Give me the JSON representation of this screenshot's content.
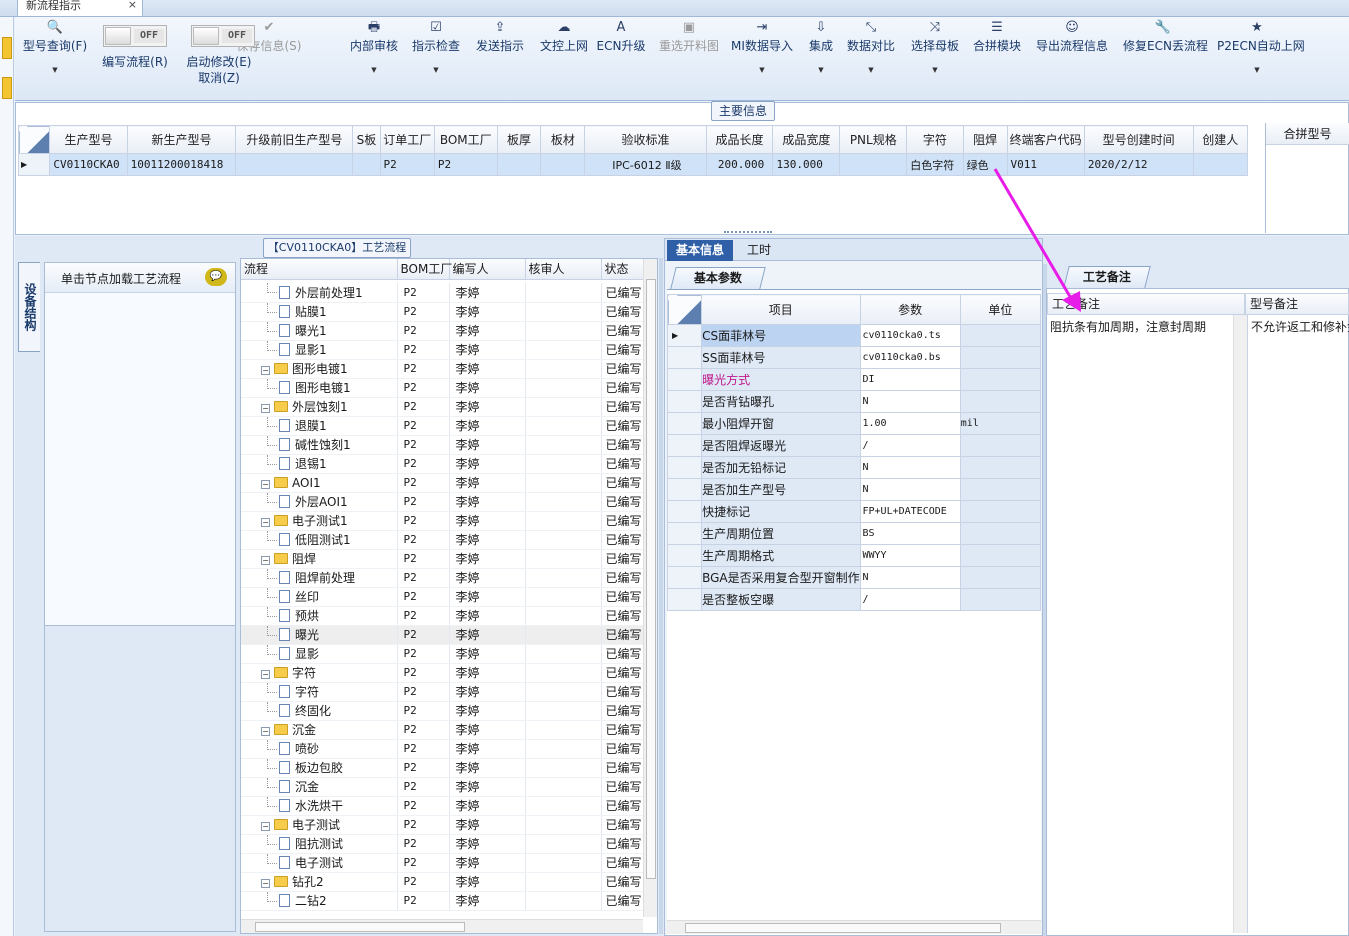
{
  "window": {
    "tab_title": "新流程指示",
    "close_glyph": "×"
  },
  "toolbar": {
    "items": [
      {
        "label": "型号查询(F)",
        "icon": "search-icon",
        "glyph": "🔍",
        "dropdown": true,
        "disabled": false
      },
      {
        "label": "保存信息(S)",
        "icon": "check-icon",
        "glyph": "✔",
        "dropdown": false,
        "disabled": true
      },
      {
        "label": "内部审核",
        "icon": "printer-icon",
        "glyph": "🖶",
        "dropdown": true,
        "disabled": false
      },
      {
        "label": "指示检查",
        "icon": "checkbox-icon",
        "glyph": "☑",
        "dropdown": true,
        "disabled": false
      },
      {
        "label": "发送指示",
        "icon": "upload-icon",
        "glyph": "⇪",
        "dropdown": false,
        "disabled": false
      },
      {
        "label": "文控上网",
        "icon": "cloud-upload-icon",
        "glyph": "☁",
        "dropdown": false,
        "disabled": false
      },
      {
        "label": "ECN升级",
        "icon": "font-icon",
        "glyph": "A",
        "dropdown": false,
        "disabled": false
      },
      {
        "label": "重选开料图",
        "icon": "image-icon",
        "glyph": "▣",
        "dropdown": false,
        "disabled": true
      },
      {
        "label": "MI数据导入",
        "icon": "sign-in-icon",
        "glyph": "⇥",
        "dropdown": true,
        "disabled": false
      },
      {
        "label": "集成",
        "icon": "download-icon",
        "glyph": "⇩",
        "dropdown": true,
        "disabled": false
      },
      {
        "label": "数据对比",
        "icon": "compress-icon",
        "glyph": "⤡",
        "dropdown": true,
        "disabled": false
      },
      {
        "label": "选择母板",
        "icon": "random-icon",
        "glyph": "⤨",
        "dropdown": true,
        "disabled": false
      },
      {
        "label": "合拼模块",
        "icon": "list-icon",
        "glyph": "☰",
        "dropdown": false,
        "disabled": false
      },
      {
        "label": "导出流程信息",
        "icon": "smile-icon",
        "glyph": "☺",
        "dropdown": false,
        "disabled": false
      },
      {
        "label": "修复ECN丢流程",
        "icon": "wrench-icon",
        "glyph": "🔧",
        "dropdown": false,
        "disabled": false
      },
      {
        "label": "P2ECN自动上网",
        "icon": "star-icon",
        "glyph": "★",
        "dropdown": true,
        "disabled": false
      }
    ],
    "toggle1": {
      "state": "OFF",
      "label": "编写流程(R)"
    },
    "toggle2": {
      "state": "OFF",
      "label": "启动修改(E)",
      "sub": "取消(Z)"
    }
  },
  "main_info": {
    "title": "主要信息",
    "columns": [
      "生产型号",
      "新生产型号",
      "升级前旧生产型号",
      "S板",
      "订单工厂",
      "BOM工厂",
      "板厚",
      "板材",
      "验收标准",
      "成品长度",
      "成品宽度",
      "PNL规格",
      "字符",
      "阻焊",
      "终端客户代码",
      "型号创建时间",
      "创建人"
    ],
    "row": [
      "CV0110CKA0",
      "10011200018418",
      "",
      "",
      "P2",
      "P2",
      "",
      "",
      "IPC-6012 Ⅱ级",
      "200.000",
      "130.000",
      "",
      "白色字符",
      "绿色",
      "V011",
      "2020/2/12",
      ""
    ],
    "merge_header": "合拼型号"
  },
  "equipment": {
    "vtab": "设备结构",
    "hint": "单击节点加载工艺流程"
  },
  "flow": {
    "title": "【CV0110CKA0】工艺流程",
    "columns": [
      "流程",
      "BOM工厂",
      "编写人",
      "核审人",
      "状态"
    ],
    "rows": [
      {
        "name": "外层前处理1",
        "level": 2,
        "factory": "P2",
        "writer": "李婷",
        "status": "已编写"
      },
      {
        "name": "贴膜1",
        "level": 2,
        "factory": "P2",
        "writer": "李婷",
        "status": "已编写"
      },
      {
        "name": "曝光1",
        "level": 2,
        "factory": "P2",
        "writer": "李婷",
        "status": "已编写"
      },
      {
        "name": "显影1",
        "level": 2,
        "factory": "P2",
        "writer": "李婷",
        "status": "已编写"
      },
      {
        "name": "图形电镀1",
        "level": 1,
        "factory": "P2",
        "writer": "李婷",
        "status": "已编写"
      },
      {
        "name": "图形电镀1",
        "level": 2,
        "factory": "P2",
        "writer": "李婷",
        "status": "已编写"
      },
      {
        "name": "外层蚀刻1",
        "level": 1,
        "factory": "P2",
        "writer": "李婷",
        "status": "已编写"
      },
      {
        "name": "退膜1",
        "level": 2,
        "factory": "P2",
        "writer": "李婷",
        "status": "已编写"
      },
      {
        "name": "碱性蚀刻1",
        "level": 2,
        "factory": "P2",
        "writer": "李婷",
        "status": "已编写"
      },
      {
        "name": "退锡1",
        "level": 2,
        "factory": "P2",
        "writer": "李婷",
        "status": "已编写"
      },
      {
        "name": "AOI1",
        "level": 1,
        "factory": "P2",
        "writer": "李婷",
        "status": "已编写"
      },
      {
        "name": "外层AOI1",
        "level": 2,
        "factory": "P2",
        "writer": "李婷",
        "status": "已编写"
      },
      {
        "name": "电子测试1",
        "level": 1,
        "factory": "P2",
        "writer": "李婷",
        "status": "已编写"
      },
      {
        "name": "低阻测试1",
        "level": 2,
        "factory": "P2",
        "writer": "李婷",
        "status": "已编写"
      },
      {
        "name": "阻焊",
        "level": 1,
        "factory": "P2",
        "writer": "李婷",
        "status": "已编写"
      },
      {
        "name": "阻焊前处理",
        "level": 2,
        "factory": "P2",
        "writer": "李婷",
        "status": "已编写"
      },
      {
        "name": "丝印",
        "level": 2,
        "factory": "P2",
        "writer": "李婷",
        "status": "已编写"
      },
      {
        "name": "预烘",
        "level": 2,
        "factory": "P2",
        "writer": "李婷",
        "status": "已编写"
      },
      {
        "name": "曝光",
        "level": 2,
        "factory": "P2",
        "writer": "李婷",
        "status": "已编写",
        "selected": true
      },
      {
        "name": "显影",
        "level": 2,
        "factory": "P2",
        "writer": "李婷",
        "status": "已编写"
      },
      {
        "name": "字符",
        "level": 1,
        "factory": "P2",
        "writer": "李婷",
        "status": "已编写"
      },
      {
        "name": "字符",
        "level": 2,
        "factory": "P2",
        "writer": "李婷",
        "status": "已编写"
      },
      {
        "name": "终固化",
        "level": 2,
        "factory": "P2",
        "writer": "李婷",
        "status": "已编写"
      },
      {
        "name": "沉金",
        "level": 1,
        "factory": "P2",
        "writer": "李婷",
        "status": "已编写"
      },
      {
        "name": "喷砂",
        "level": 2,
        "factory": "P2",
        "writer": "李婷",
        "status": "已编写"
      },
      {
        "name": "板边包胶",
        "level": 2,
        "factory": "P2",
        "writer": "李婷",
        "status": "已编写"
      },
      {
        "name": "沉金",
        "level": 2,
        "factory": "P2",
        "writer": "李婷",
        "status": "已编写"
      },
      {
        "name": "水洗烘干",
        "level": 2,
        "factory": "P2",
        "writer": "李婷",
        "status": "已编写"
      },
      {
        "name": "电子测试",
        "level": 1,
        "factory": "P2",
        "writer": "李婷",
        "status": "已编写"
      },
      {
        "name": "阻抗测试",
        "level": 2,
        "factory": "P2",
        "writer": "李婷",
        "status": "已编写"
      },
      {
        "name": "电子测试",
        "level": 2,
        "factory": "P2",
        "writer": "李婷",
        "status": "已编写"
      },
      {
        "name": "钻孔2",
        "level": 1,
        "factory": "P2",
        "writer": "李婷",
        "status": "已编写"
      },
      {
        "name": "二钻2",
        "level": 2,
        "factory": "P2",
        "writer": "李婷",
        "status": "已编写"
      }
    ]
  },
  "basic": {
    "tabs": [
      "基本信息",
      "工时"
    ],
    "subtab": "基本参数",
    "columns": [
      "项目",
      "参数",
      "单位"
    ],
    "rows": [
      {
        "item": "CS面菲林号",
        "value": "cv0110cka0.ts",
        "unit": "",
        "highlight": true
      },
      {
        "item": "SS面菲林号",
        "value": "cv0110cka0.bs",
        "unit": ""
      },
      {
        "item": "曝光方式",
        "value": "DI",
        "unit": "",
        "pink": true
      },
      {
        "item": "是否背钻曝孔",
        "value": "N",
        "unit": ""
      },
      {
        "item": "最小阻焊开窗",
        "value": "1.00",
        "unit": "mil"
      },
      {
        "item": "是否阻焊返曝光",
        "value": "/",
        "unit": ""
      },
      {
        "item": "是否加无铅标记",
        "value": "N",
        "unit": ""
      },
      {
        "item": "是否加生产型号",
        "value": "N",
        "unit": ""
      },
      {
        "item": "快捷标记",
        "value": "FP+UL+DATECODE",
        "unit": ""
      },
      {
        "item": "生产周期位置",
        "value": "BS",
        "unit": ""
      },
      {
        "item": "生产周期格式",
        "value": "WWYY",
        "unit": ""
      },
      {
        "item": "BGA是否采用复合型开窗制作",
        "value": "N",
        "unit": ""
      },
      {
        "item": "是否整板空曝",
        "value": "/",
        "unit": ""
      }
    ]
  },
  "craft": {
    "tab": "工艺备注",
    "columns": [
      "工艺备注",
      "型号备注"
    ],
    "note": "阻抗条有加周期，注意封周期",
    "model_note": "不允许返工和修补金"
  },
  "colors": {
    "accent": "#cfe2f7",
    "arrow": "#e81ce8",
    "header": "#e9eef6",
    "pink_text": "#c0168a"
  }
}
